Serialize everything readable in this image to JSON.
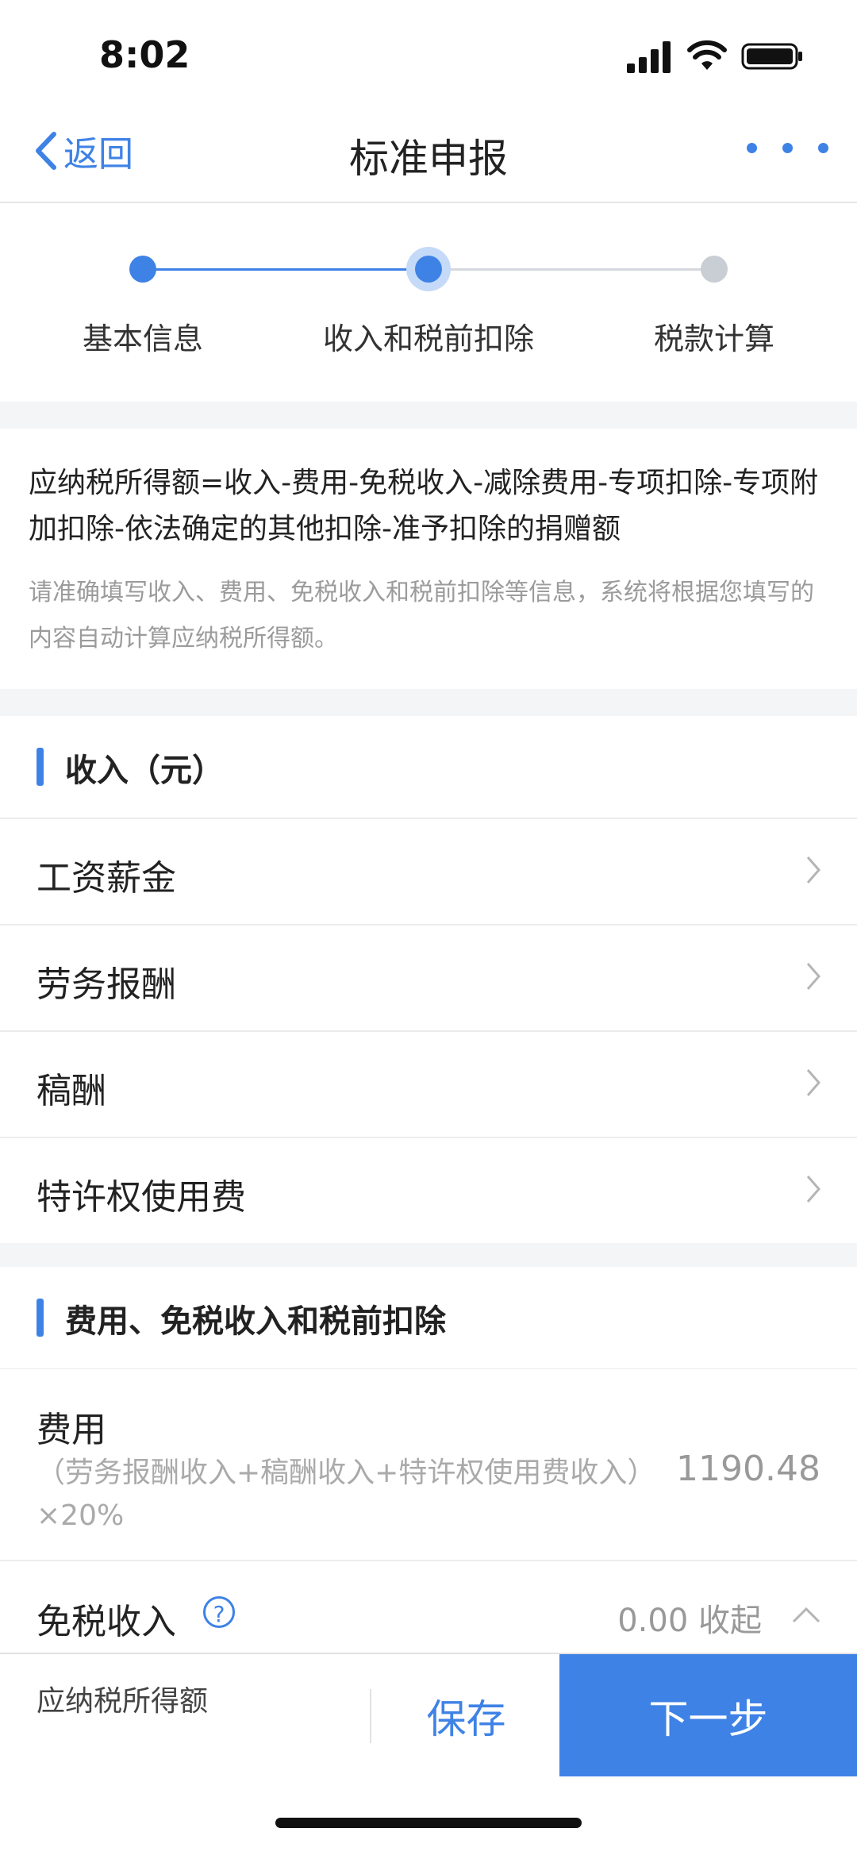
{
  "status_bar": {
    "time": "8:02"
  },
  "nav": {
    "back_label": "返回",
    "title": "标准申报"
  },
  "steps": [
    {
      "label": "基本信息",
      "state": "done"
    },
    {
      "label": "收入和税前扣除",
      "state": "current"
    },
    {
      "label": "税款计算",
      "state": "todo"
    }
  ],
  "info": {
    "formula": "应纳税所得额=收入-费用-免税收入-减除费用-专项扣除-专项附加扣除-依法确定的其他扣除-准予扣除的捐赠额",
    "hint": "请准确填写收入、费用、免税收入和税前扣除等信息，系统将根据您填写的内容自动计算应纳税所得额。"
  },
  "income": {
    "title": "收入（元）",
    "items": [
      {
        "label": "工资薪金"
      },
      {
        "label": "劳务报酬"
      },
      {
        "label": "稿酬"
      },
      {
        "label": "特许权使用费"
      }
    ]
  },
  "deductions": {
    "title": "费用、免税收入和税前扣除",
    "fee_label": "费用",
    "fee_formula": "（劳务报酬收入+稿酬收入+特许权使用费收入）×20%",
    "fee_value": "1190.48",
    "exempt_label": "免税收入",
    "exempt_value": "0.00 收起"
  },
  "bottom": {
    "tax_label": "应纳税所得额",
    "save_label": "保存",
    "next_label": "下一步"
  },
  "colors": {
    "accent": "#3e82e6",
    "inactive": "#c9cdd4"
  }
}
